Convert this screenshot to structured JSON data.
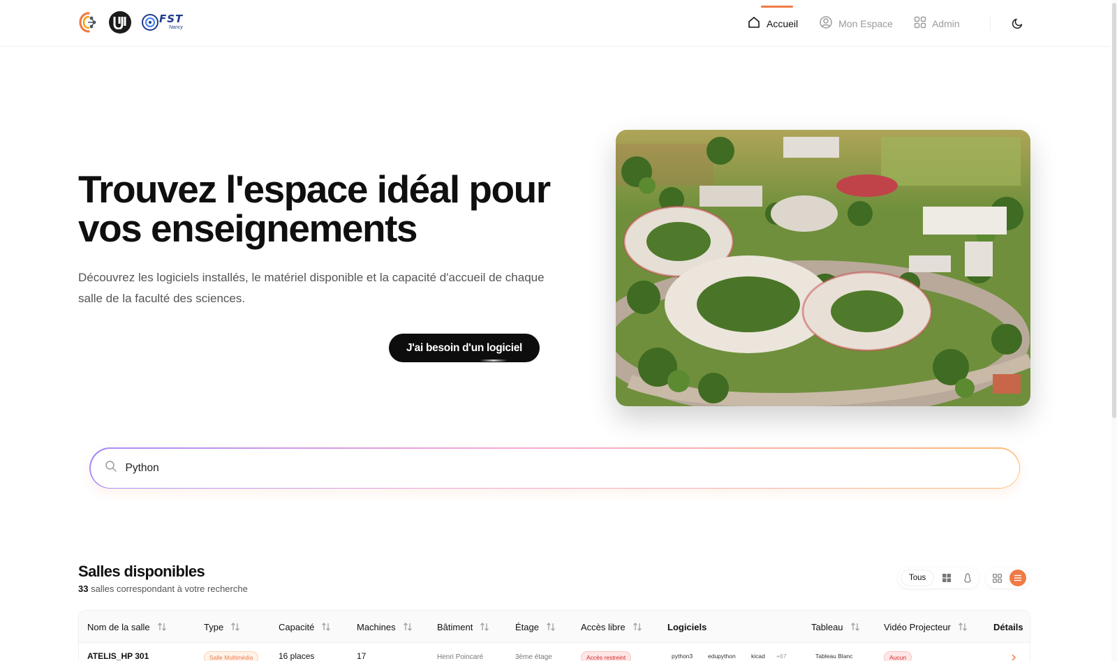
{
  "header": {
    "nav": [
      {
        "label": "Accueil",
        "icon": "home-icon",
        "active": true
      },
      {
        "label": "Mon Espace",
        "icon": "user-circle-icon",
        "active": false
      },
      {
        "label": "Admin",
        "icon": "grid-icon",
        "active": false
      }
    ],
    "theme_icon": "moon-icon",
    "logo3_text": "FST",
    "logo3_sub": "Nancy"
  },
  "hero": {
    "title_line1": "Trouvez l'espace idéal pour",
    "title_line2": "vos enseignements",
    "subtitle": "Découvrez les logiciels installés, le matériel disponible et la capacité d'accueil de chaque salle de la faculté des sciences.",
    "cta_label": "J'ai besoin d'un logiciel"
  },
  "search": {
    "value": "Python",
    "icon": "search-icon"
  },
  "results": {
    "title": "Salles disponibles",
    "count": "33",
    "count_text": "salles correspondant à votre recherche",
    "filter_all": "Tous",
    "filter_icons": [
      "windows-icon",
      "linux-icon"
    ],
    "view_icons": [
      "grid-view-icon",
      "list-view-icon"
    ]
  },
  "table": {
    "columns": [
      "Nom de la salle",
      "Type",
      "Capacité",
      "Machines",
      "Bâtiment",
      "Étage",
      "Accès libre",
      "Logiciels",
      "Tableau",
      "Vidéo Projecteur",
      "Détails"
    ],
    "rows": [
      {
        "name": "ATELIS_HP 301",
        "type": "Salle Multimédia",
        "capacity": "16 places",
        "machines": "17",
        "building": "Henri Poincaré",
        "floor": "3ème étage",
        "access": "Accès restreint",
        "software": [
          "python3",
          "edupython",
          "kicad"
        ],
        "software_more": "+67",
        "board": "Tableau Blanc",
        "projector": "Aucun"
      }
    ]
  },
  "colors": {
    "accent": "#f07a45",
    "text": "#111111",
    "muted": "#9a9a9a"
  }
}
